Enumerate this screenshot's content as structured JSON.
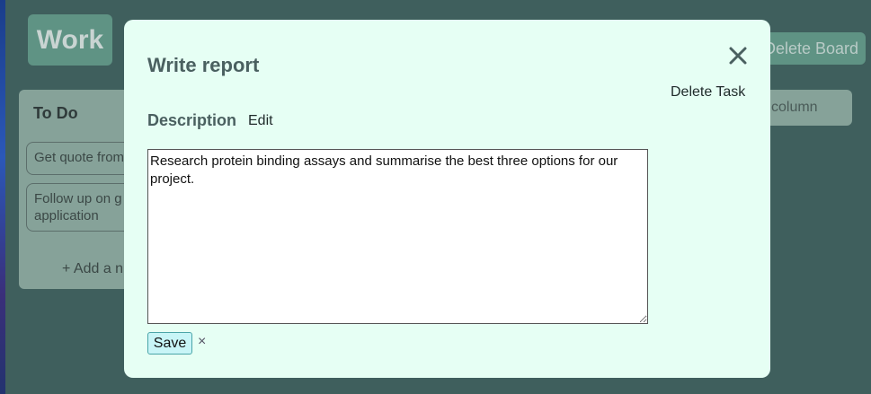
{
  "board": {
    "title": "Work",
    "delete_board_label": "Delete Board",
    "add_column_label": "column"
  },
  "column": {
    "title": "To Do",
    "cards": [
      {
        "text": "Get quote from"
      },
      {
        "text": "Follow up on g application"
      }
    ],
    "add_card_label": "+ Add a n"
  },
  "modal": {
    "title": "Write report",
    "delete_task_label": "Delete Task",
    "description_label": "Description",
    "edit_label": "Edit",
    "description_value": "Research protein binding assays and summarise the best three options for our project.",
    "save_label": "Save",
    "cancel_label": "×"
  },
  "colors": {
    "background": "#3f5f5d",
    "modal": "#e6fff4",
    "accent": "#5f9384",
    "save_bg": "#c8f5f7"
  },
  "icons": {
    "close": "close-icon"
  }
}
